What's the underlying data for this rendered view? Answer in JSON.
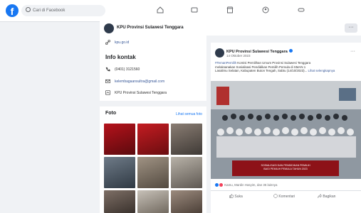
{
  "search": {
    "placeholder": "Cari di Facebook"
  },
  "nav": {
    "icons": [
      "home-icon",
      "video-icon",
      "marketplace-icon",
      "groups-icon",
      "gaming-icon"
    ]
  },
  "page": {
    "name": "KPU Provinsi Sulawesi Tenggara"
  },
  "contact": {
    "website": "kpu.go.id",
    "title": "Info kontak",
    "phone": "(0401) 3121560",
    "email": "kelembagaansultra@gmail.com",
    "category": "KPU Provinsi Sulawesi Tenggara"
  },
  "photos": {
    "title": "Foto",
    "see_all": "Lihat semua foto"
  },
  "post": {
    "author": "KPU Provinsi Sulawesi Tenggara",
    "date": "14 Oktober 2023",
    "hashtag": "#TemanPemilih",
    "text1": " Komisi Pemilihan Umum Provinsi Sulawesi Tenggara",
    "text2": "melaksanakan Sosialisasi Pendidikan Pemilih Pemula di SMAN 1",
    "text3": "Lasalimu Selatan, Kabupaten Buton Tengah, Sabtu (14/10/2023)...",
    "see_more": "Lihat selengkapnya",
    "banner_line1": "SOSIALISASI DAN PENDIDIKAN PEMILIH",
    "banner_line2": "BAGI PEMILIH PEMULA TAHUN 2023",
    "reactions": "Kamu, Mardin Hasyim, dan 36 lainnya",
    "like": "Suka",
    "comment": "Komentari",
    "share": "Bagikan"
  },
  "colors": {
    "brand": "#1877f2",
    "banner": "#8d1218"
  }
}
